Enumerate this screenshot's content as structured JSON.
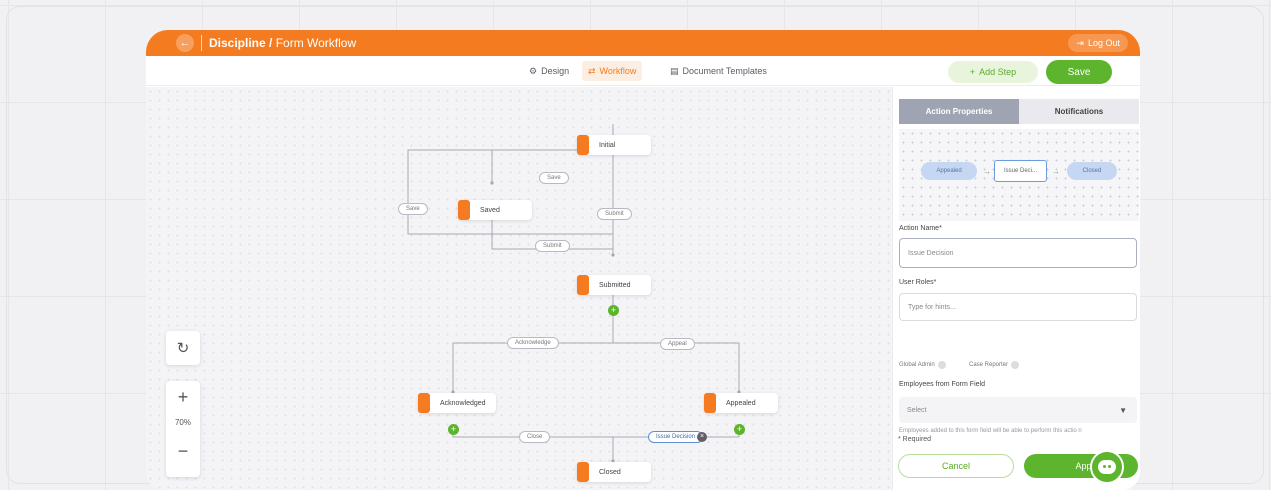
{
  "header": {
    "back_icon": "arrow-left-icon",
    "title_bold": "Discipline /",
    "title_rest": " Form Workflow",
    "logout_label": "Log Out",
    "logout_icon": "logout-icon",
    "accent_color": "#f47b20"
  },
  "tabs": [
    {
      "label": "Design",
      "icon": "gear-icon"
    },
    {
      "label": "Workflow",
      "icon": "workflow-icon",
      "active": true
    },
    {
      "label": "Document Templates",
      "icon": "document-icon"
    }
  ],
  "toolbar": {
    "add_step_label": "Add Step",
    "save_label": "Save"
  },
  "workflow": {
    "nodes": [
      "Initial",
      "Saved",
      "Submitted",
      "Acknowledged",
      "Appealed",
      "Closed"
    ],
    "edge_labels": [
      "Save",
      "Save",
      "Submit",
      "Submit",
      "Acknowledge",
      "Appeal",
      "Close",
      "Issue Decision"
    ],
    "selected_edge": "Issue Decision"
  },
  "canvas_controls": {
    "refresh_icon": "refresh-icon",
    "zoom_in": "+",
    "zoom_level": "70%",
    "zoom_out": "−"
  },
  "panel": {
    "tab_properties": "Action Properties",
    "tab_notifications": "Notifications",
    "preview": {
      "from": "Appealed",
      "action": "Issue Deci...",
      "to": "Closed"
    },
    "action_name_label": "Action Name*",
    "action_name_value": "Issue Decision",
    "user_roles_label": "User Roles*",
    "user_roles_placeholder": "Type for hints...",
    "roles": [
      "Global Admin",
      "Case Reporter"
    ],
    "employees_label": "Employees from Form Field",
    "employees_placeholder": "Select",
    "employees_hint": "Employees added to this form field will be able to perform this actio n",
    "required_note": "* Required",
    "cancel_label": "Cancel",
    "apply_label": "Apply"
  },
  "colors": {
    "green": "#5cb52c",
    "orange": "#f47b20"
  }
}
